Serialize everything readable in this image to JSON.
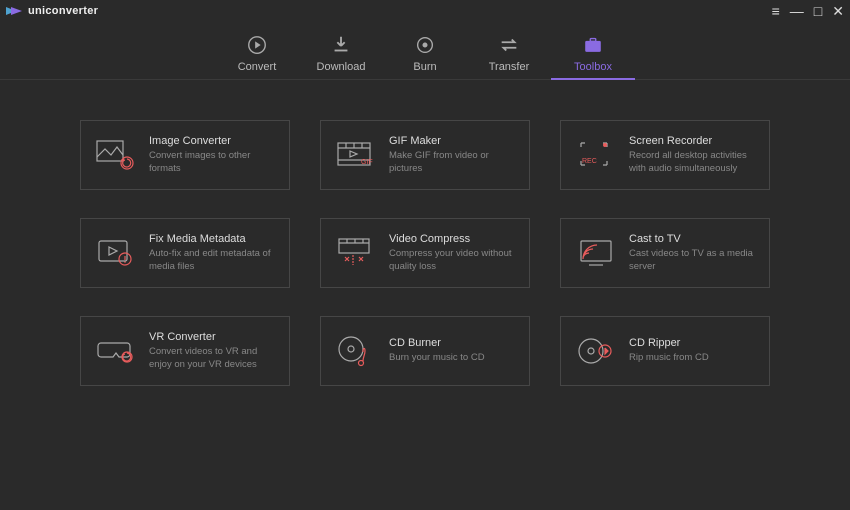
{
  "app": {
    "name": "uniconverter"
  },
  "colors": {
    "accent": "#8a6be2",
    "accent2": "#e85c5c"
  },
  "nav": {
    "items": [
      {
        "label": "Convert"
      },
      {
        "label": "Download"
      },
      {
        "label": "Burn"
      },
      {
        "label": "Transfer"
      },
      {
        "label": "Toolbox"
      }
    ],
    "active_index": 4
  },
  "tools": [
    {
      "title": "Image Converter",
      "desc": "Convert images to other formats"
    },
    {
      "title": "GIF Maker",
      "desc": "Make GIF from video or pictures"
    },
    {
      "title": "Screen Recorder",
      "desc": "Record all desktop activities with audio simultaneously"
    },
    {
      "title": "Fix Media Metadata",
      "desc": "Auto-fix and edit metadata of media files"
    },
    {
      "title": "Video Compress",
      "desc": "Compress your video without quality loss"
    },
    {
      "title": "Cast to TV",
      "desc": "Cast videos to TV as a media server"
    },
    {
      "title": "VR Converter",
      "desc": "Convert videos to VR and enjoy on your VR devices"
    },
    {
      "title": "CD Burner",
      "desc": "Burn your music to CD"
    },
    {
      "title": "CD Ripper",
      "desc": "Rip music from CD"
    }
  ]
}
